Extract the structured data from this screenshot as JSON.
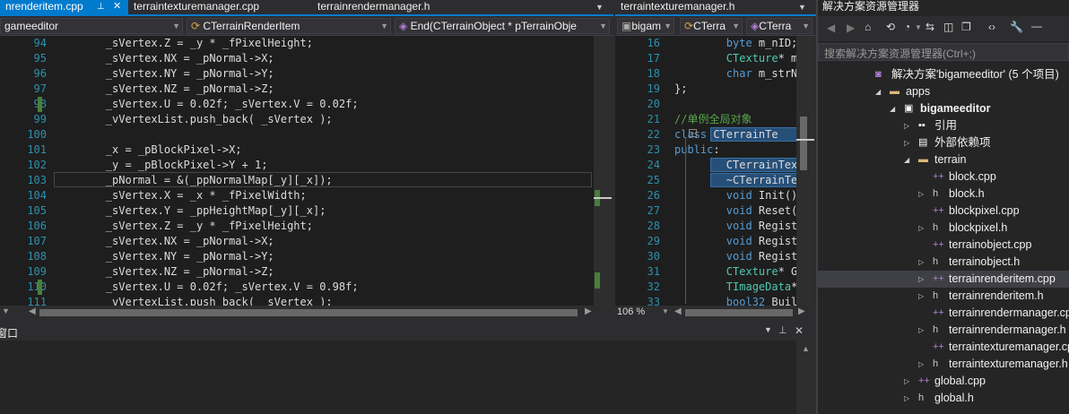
{
  "tabs": {
    "left": [
      {
        "label": "nrenderitem.cpp"
      },
      {
        "label": "terraintexturemanager.cpp"
      },
      {
        "label": "terrainrendermanager.h"
      }
    ],
    "right": [
      {
        "label": "terraintexturemanager.h"
      }
    ]
  },
  "left_nav": {
    "project": "gameeditor",
    "klass": "CTerrainRenderItem",
    "member": "End(CTerrainObject * pTerrainObje"
  },
  "right_nav": {
    "project": "bigam",
    "klass": "CTerra",
    "member": "CTerra"
  },
  "left_editor": {
    "lines": [
      {
        "n": "94",
        "t": "        _sVertex.Z = _y * _fPixelHeight;"
      },
      {
        "n": "95",
        "t": "        _sVertex.NX = _pNormal->X;"
      },
      {
        "n": "96",
        "t": "        _sVertex.NY = _pNormal->Y;"
      },
      {
        "n": "97",
        "t": "        _sVertex.NZ = _pNormal->Z;"
      },
      {
        "n": "98",
        "t": "        _sVertex.U = 0.02f; _sVertex.V = 0.02f;"
      },
      {
        "n": "99",
        "t": "        _vVertexList.push_back( _sVertex );"
      },
      {
        "n": "100",
        "t": ""
      },
      {
        "n": "101",
        "t": "        _x = _pBlockPixel->X;"
      },
      {
        "n": "102",
        "t": "        _y = _pBlockPixel->Y + 1;"
      },
      {
        "n": "103",
        "t": "        _pNormal = &(_ppNormalMap[_y][_x]);"
      },
      {
        "n": "104",
        "t": "        _sVertex.X = _x * _fPixelWidth;"
      },
      {
        "n": "105",
        "t": "        _sVertex.Y = _ppHeightMap[_y][_x];"
      },
      {
        "n": "106",
        "t": "        _sVertex.Z = _y * _fPixelHeight;"
      },
      {
        "n": "107",
        "t": "        _sVertex.NX = _pNormal->X;"
      },
      {
        "n": "108",
        "t": "        _sVertex.NY = _pNormal->Y;"
      },
      {
        "n": "109",
        "t": "        _sVertex.NZ = _pNormal->Z;"
      },
      {
        "n": "110",
        "t": "        _sVertex.U = 0.02f; _sVertex.V = 0.98f;"
      },
      {
        "n": "111",
        "t": "        _vVertexList.push_back( _sVertex );"
      }
    ]
  },
  "right_editor": {
    "lines": [
      {
        "n": "16",
        "t": "        byte m_nID;"
      },
      {
        "n": "17",
        "t": "        CTexture* m_"
      },
      {
        "n": "18",
        "t": "        char m_strNa"
      },
      {
        "n": "19",
        "t": "};"
      },
      {
        "n": "20",
        "t": ""
      },
      {
        "n": "21",
        "t": "//单例全局对象"
      },
      {
        "n": "22",
        "t": "class CTerrainTe"
      },
      {
        "n": "23",
        "t": "public:"
      },
      {
        "n": "24",
        "t": "        CTerrainText"
      },
      {
        "n": "25",
        "t": "        ~CTerrainTex"
      },
      {
        "n": "26",
        "t": "        void Init();"
      },
      {
        "n": "27",
        "t": "        void Reset()"
      },
      {
        "n": "28",
        "t": "        void Registe"
      },
      {
        "n": "29",
        "t": "        void Registe"
      },
      {
        "n": "30",
        "t": "        void Registe"
      },
      {
        "n": "31",
        "t": "        CTexture* Ge"
      },
      {
        "n": "32",
        "t": "        TImageData*"
      },
      {
        "n": "33",
        "t": "        bool32 Build"
      }
    ],
    "zoom": "106 %"
  },
  "bottom_panel": {
    "title": "窗口"
  },
  "solution_explorer": {
    "title": "解决方案资源管理器",
    "search_placeholder": "搜索解决方案资源管理器(Ctrl+;)",
    "items": [
      {
        "label": "解决方案'bigameeditor' (5 个项目)",
        "indent": 0,
        "icon": "solution",
        "exp": ""
      },
      {
        "label": "apps",
        "indent": 1,
        "icon": "folder",
        "exp": "open"
      },
      {
        "label": "bigameeditor",
        "indent": 2,
        "icon": "project",
        "exp": "open",
        "bold": true
      },
      {
        "label": "引用",
        "indent": 3,
        "icon": "refs",
        "exp": "closed"
      },
      {
        "label": "外部依赖项",
        "indent": 3,
        "icon": "extdeps",
        "exp": "closed"
      },
      {
        "label": "terrain",
        "indent": 3,
        "icon": "folder",
        "exp": "open"
      },
      {
        "label": "block.cpp",
        "indent": 4,
        "icon": "cpp",
        "exp": ""
      },
      {
        "label": "block.h",
        "indent": 4,
        "icon": "h",
        "exp": "closed"
      },
      {
        "label": "blockpixel.cpp",
        "indent": 4,
        "icon": "cpp",
        "exp": ""
      },
      {
        "label": "blockpixel.h",
        "indent": 4,
        "icon": "h",
        "exp": "closed"
      },
      {
        "label": "terrainobject.cpp",
        "indent": 4,
        "icon": "cpp",
        "exp": ""
      },
      {
        "label": "terrainobject.h",
        "indent": 4,
        "icon": "h",
        "exp": "closed"
      },
      {
        "label": "terrainrenderitem.cpp",
        "indent": 4,
        "icon": "cpp",
        "exp": "closed",
        "selected": true
      },
      {
        "label": "terrainrenderitem.h",
        "indent": 4,
        "icon": "h",
        "exp": "closed"
      },
      {
        "label": "terrainrendermanager.cpp",
        "indent": 4,
        "icon": "cpp",
        "exp": ""
      },
      {
        "label": "terrainrendermanager.h",
        "indent": 4,
        "icon": "h",
        "exp": "closed"
      },
      {
        "label": "terraintexturemanager.cpp",
        "indent": 4,
        "icon": "cpp",
        "exp": ""
      },
      {
        "label": "terraintexturemanager.h",
        "indent": 4,
        "icon": "h",
        "exp": "closed"
      },
      {
        "label": "global.cpp",
        "indent": 3,
        "icon": "cpp",
        "exp": "closed"
      },
      {
        "label": "global.h",
        "indent": 3,
        "icon": "h",
        "exp": "closed"
      }
    ]
  },
  "colors": {
    "accent": "#007acc",
    "editor_bg": "#1e1e1e",
    "chrome_bg": "#2d2d30",
    "line_number": "#2b91af",
    "keyword": "#569cd6",
    "type": "#4ec9b0",
    "comment": "#57a64a",
    "changed": "#487e3a"
  }
}
